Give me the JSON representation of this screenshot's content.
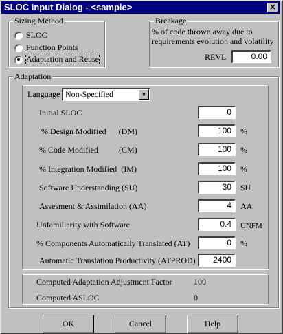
{
  "title": "SLOC Input Dialog - <sample>",
  "close_label": "✕",
  "sizing": {
    "legend": "Sizing Method",
    "options": [
      "SLOC",
      "Function Points",
      "Adaptation and Reuse"
    ],
    "selected": 2
  },
  "breakage": {
    "legend": "Breakage",
    "desc1": "% of code thrown away due to",
    "desc2": "requirements evolution and volatility",
    "revl_label": "REVL",
    "revl_value": "0.00"
  },
  "adaptation": {
    "legend": "Adaptation",
    "language_label": "Language",
    "language_value": "Non-Specified",
    "rows": [
      {
        "label": "Initial SLOC",
        "value": "0",
        "unit": ""
      },
      {
        "label": " % Design Modified      (DM)",
        "value": "100",
        "unit": "%"
      },
      {
        "label": "% Code Modified          (CM)",
        "value": "100",
        "unit": "%"
      },
      {
        "label": "% Integration Modified  (IM)",
        "value": "100",
        "unit": "%"
      },
      {
        "label": "Software Understanding (SU)",
        "value": "30",
        "unit": "SU"
      },
      {
        "label": "Assesment & Assimilation (AA)",
        "value": "4",
        "unit": "AA"
      },
      {
        "label": "Unfamiliarity with Software",
        "value": "0.4",
        "unit": "UNFM"
      },
      {
        "label": "% Components Automatically Translated (AT)",
        "value": "0",
        "unit": "%"
      },
      {
        "label": "Automatic Translation Productivity (ATPROD)",
        "value": "2400",
        "unit": ""
      }
    ]
  },
  "computed": {
    "aaf_label": "Computed Adaptation Adjustment Factor",
    "aaf_value": "100",
    "asloc_label": "Computed ASLOC",
    "asloc_value": "0"
  },
  "buttons": {
    "ok": "OK",
    "cancel": "Cancel",
    "help": "Help"
  }
}
